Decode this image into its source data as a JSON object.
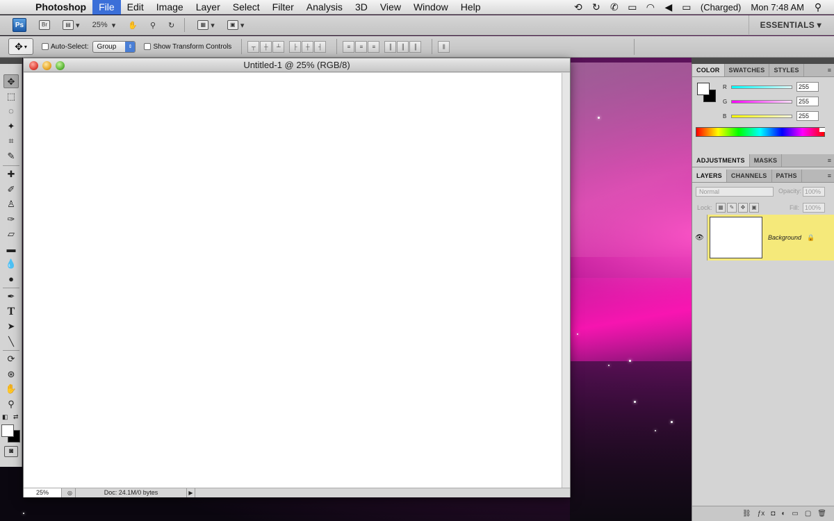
{
  "menubar": {
    "app_name": "Photoshop",
    "items": [
      "File",
      "Edit",
      "Image",
      "Layer",
      "Select",
      "Filter",
      "Analysis",
      "3D",
      "View",
      "Window",
      "Help"
    ],
    "battery": "(Charged)",
    "clock": "Mon 7:48 AM"
  },
  "appbar": {
    "ps_label": "Ps",
    "br_label": "Br",
    "zoom": "25%",
    "workspace": "ESSENTIALS"
  },
  "options": {
    "auto_select_label": "Auto-Select:",
    "auto_select_value": "Group",
    "transform_label": "Show Transform Controls"
  },
  "document": {
    "title": "Untitled-1 @ 25% (RGB/8)",
    "zoom": "25%",
    "doc_info": "Doc: 24.1M/0 bytes"
  },
  "color_panel": {
    "tabs": [
      "COLOR",
      "SWATCHES",
      "STYLES"
    ],
    "r_label": "R",
    "g_label": "G",
    "b_label": "B",
    "r_value": "255",
    "g_value": "255",
    "b_value": "255"
  },
  "adjustments_panel": {
    "tabs": [
      "ADJUSTMENTS",
      "MASKS"
    ]
  },
  "layers_panel": {
    "tabs": [
      "LAYERS",
      "CHANNELS",
      "PATHS"
    ],
    "blend_mode": "Normal",
    "opacity_label": "Opacity:",
    "opacity_value": "100%",
    "lock_label": "Lock:",
    "fill_label": "Fill:",
    "fill_value": "100%",
    "layers": [
      {
        "name": "Background"
      }
    ]
  }
}
